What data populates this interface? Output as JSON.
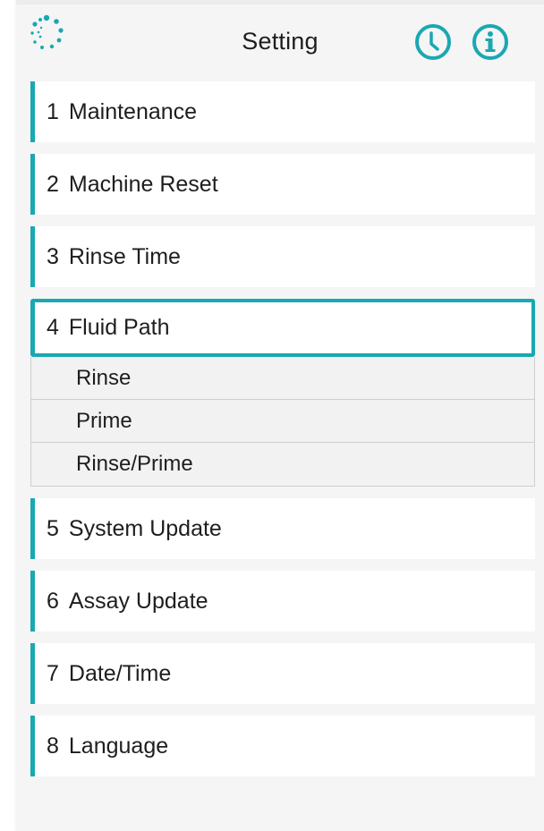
{
  "header": {
    "title": "Setting",
    "logo_icon": "loading-ring-icon",
    "clock_icon": "clock-icon",
    "info_icon": "info-icon",
    "accent": "#1aa8b2"
  },
  "menu": {
    "items": [
      {
        "num": "1",
        "label": "Maintenance"
      },
      {
        "num": "2",
        "label": "Machine Reset"
      },
      {
        "num": "3",
        "label": "Rinse Time"
      },
      {
        "num": "4",
        "label": "Fluid Path",
        "active": true
      },
      {
        "num": "5",
        "label": "System Update"
      },
      {
        "num": "6",
        "label": "Assay Update"
      },
      {
        "num": "7",
        "label": "Date/Time"
      },
      {
        "num": "8",
        "label": "Language"
      }
    ],
    "fluid_path_subitems": [
      "Rinse",
      "Prime",
      "Rinse/Prime"
    ]
  }
}
